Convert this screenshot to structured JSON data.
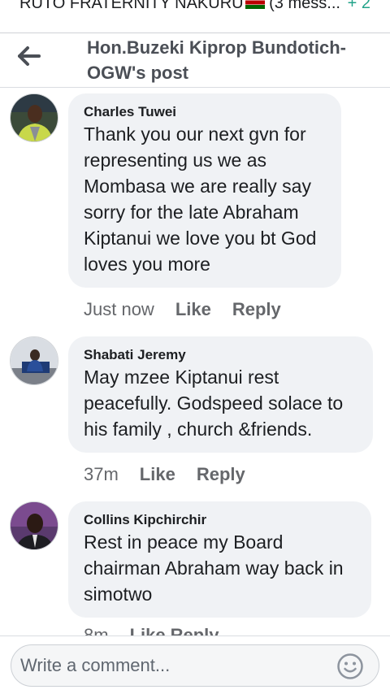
{
  "notification": {
    "text": "RUTO FRATERNITY NAKURU",
    "suffix": " (3 mess...",
    "count": "+ 2"
  },
  "header": {
    "title": "Hon.Buzeki Kiprop Bundotich-OGW's post"
  },
  "comments": [
    {
      "author": "Charles Tuwei",
      "text": "Thank you our next gvn for representing us we as Mombasa we are really say sorry for the late Abraham Kiptanui we love you bt God loves you more",
      "time": "Just now",
      "like": "Like",
      "reply": "Reply"
    },
    {
      "author": "Shabati Jeremy",
      "text": "May mzee Kiptanui rest peacefully. Godspeed solace to his family , church &friends.",
      "time": "37m",
      "like": "Like",
      "reply": "Reply"
    },
    {
      "author": "Collins Kipchirchir",
      "text": "Rest in peace my Board chairman Abraham way back in simotwo",
      "time": "8m",
      "like": "Like",
      "reply": "Reply"
    }
  ],
  "footer": {
    "placeholder": "Write a comment..."
  }
}
